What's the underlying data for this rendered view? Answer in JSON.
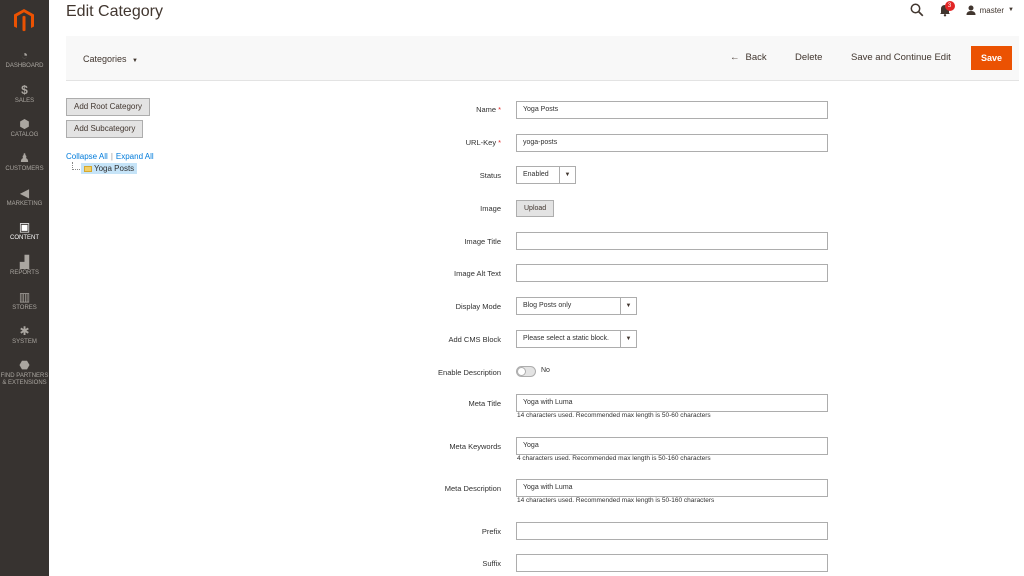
{
  "sidebar": {
    "items": [
      {
        "label": "DASHBOARD",
        "icon": "dashboard-icon"
      },
      {
        "label": "SALES",
        "icon": "dollar-icon"
      },
      {
        "label": "CATALOG",
        "icon": "cube-icon"
      },
      {
        "label": "CUSTOMERS",
        "icon": "person-icon"
      },
      {
        "label": "MARKETING",
        "icon": "megaphone-icon"
      },
      {
        "label": "CONTENT",
        "icon": "content-icon"
      },
      {
        "label": "REPORTS",
        "icon": "bar-chart-icon"
      },
      {
        "label": "STORES",
        "icon": "store-icon"
      },
      {
        "label": "SYSTEM",
        "icon": "gear-icon"
      },
      {
        "label": "FIND PARTNERS & EXTENSIONS",
        "icon": "box-icon"
      }
    ]
  },
  "header": {
    "title": "Edit Category",
    "notification_count": "3",
    "username": "master"
  },
  "actionbar": {
    "store_switcher": "Categories",
    "back_label": "Back",
    "delete_label": "Delete",
    "save_continue_label": "Save and Continue Edit",
    "save_label": "Save"
  },
  "tree": {
    "add_root_label": "Add Root Category",
    "add_sub_label": "Add Subcategory",
    "collapse_all": "Collapse All",
    "separator": "|",
    "expand_all": "Expand All",
    "node_label": "Yoga Posts"
  },
  "form": {
    "name_label": "Name",
    "name_value": "Yoga Posts",
    "urlkey_label": "URL-Key",
    "urlkey_value": "yoga-posts",
    "status_label": "Status",
    "status_value": "Enabled",
    "image_label": "Image",
    "upload_label": "Upload",
    "image_title_label": "Image Title",
    "image_title_value": "",
    "image_alt_label": "Image Alt Text",
    "image_alt_value": "",
    "display_mode_label": "Display Mode",
    "display_mode_value": "Blog Posts only",
    "cms_block_label": "Add CMS Block",
    "cms_block_value": "Please select a static block.",
    "enable_desc_label": "Enable Description",
    "enable_desc_value": "No",
    "meta_title_label": "Meta Title",
    "meta_title_value": "Yoga with Luma",
    "meta_title_note": "14 characters used. Recommended max length is 50-60 characters",
    "meta_keywords_label": "Meta Keywords",
    "meta_keywords_value": "Yoga",
    "meta_keywords_note": "4 characters used. Recommended max length is 50-160 characters",
    "meta_desc_label": "Meta Description",
    "meta_desc_value": "Yoga with Luma",
    "meta_desc_note": "14 characters used. Recommended max length is 50-160 characters",
    "prefix_label": "Prefix",
    "prefix_value": "",
    "suffix_label": "Suffix",
    "suffix_value": ""
  },
  "colors": {
    "sidebar_bg": "#373330",
    "accent": "#eb5202",
    "link": "#007bdb",
    "required": "#e22626"
  }
}
